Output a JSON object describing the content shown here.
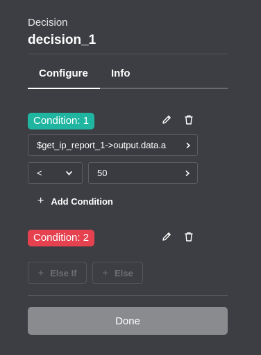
{
  "header": {
    "subtitle": "Decision",
    "title": "decision_1"
  },
  "tabs": [
    {
      "label": "Configure",
      "active": true
    },
    {
      "label": "Info",
      "active": false
    }
  ],
  "conditions": [
    {
      "label": "Condition: 1",
      "color": "#1fb5a0",
      "left_operand": "$get_ip_report_1->output.data.a",
      "operator": "<",
      "right_operand": "50"
    },
    {
      "label": "Condition: 2",
      "color": "#e5414f"
    }
  ],
  "add_condition_label": "Add Condition",
  "else_if_label": "Else If",
  "else_label": "Else",
  "done_label": "Done",
  "icons": {
    "edit": "pencil-icon",
    "delete": "trash-icon",
    "chevron_right": "chevron-right-icon",
    "chevron_down": "chevron-down-icon",
    "plus": "plus-icon"
  }
}
